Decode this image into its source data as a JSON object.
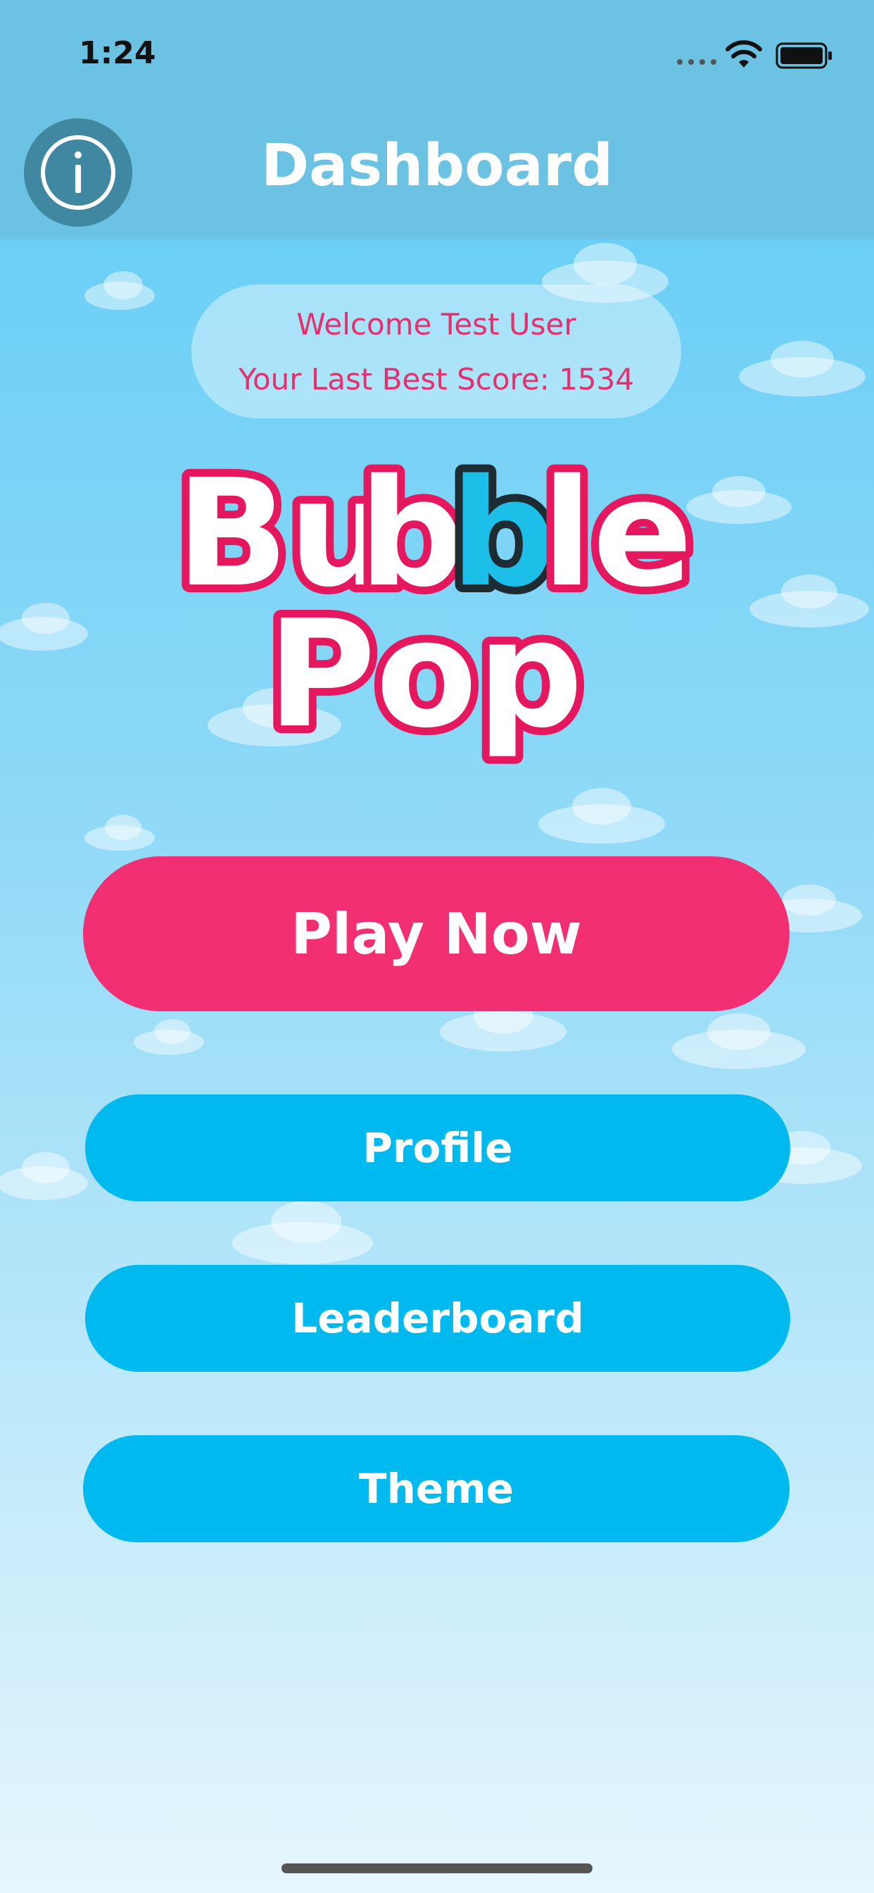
{
  "status_bar": {
    "time": "1:24",
    "icons": [
      "signal-dots-icon",
      "wifi-icon",
      "battery-icon"
    ]
  },
  "nav": {
    "title": "Dashboard",
    "info_icon": "info-icon"
  },
  "welcome": {
    "greeting": "Welcome Test User",
    "score_line": "Your Last Best Score: 1534"
  },
  "logo": {
    "text": "Bubble Pop"
  },
  "buttons": {
    "play": "Play Now",
    "profile": "Profile",
    "leaderboard": "Leaderboard",
    "theme": "Theme"
  },
  "colors": {
    "header": "#6bc2e2",
    "primary_button": "#f12f72",
    "secondary_button": "#00b9ee",
    "welcome_text": "#e5306f"
  }
}
